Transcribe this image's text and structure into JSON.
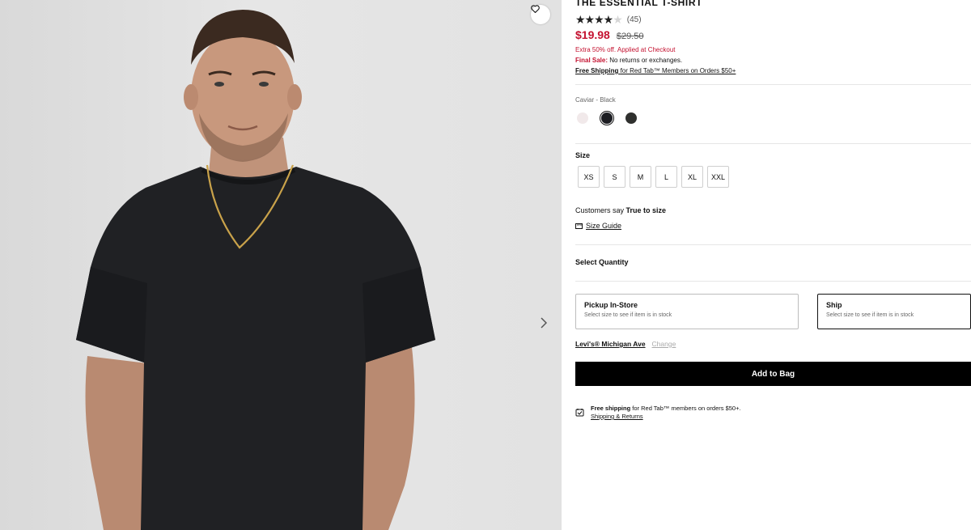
{
  "product": {
    "title": "THE ESSENTIAL T-SHIRT",
    "rating_stars": "★★★★",
    "rating_empty": "★",
    "rating_count": "(45)",
    "price": "$19.98",
    "price_original": "$29.50",
    "promo": "Extra 50% off. Applied at Checkout",
    "final_sale_label": "Final Sale:",
    "final_sale_text": "No returns or exchanges.",
    "free_shipping_bold": "Free Shipping",
    "free_shipping_text": "for Red Tab™ Members on Orders $50+"
  },
  "color": {
    "label": "Caviar - Black",
    "swatches": [
      {
        "name": "light",
        "hex": "#f1e9ea"
      },
      {
        "name": "caviar-black",
        "hex": "#1c1d22",
        "selected": true
      },
      {
        "name": "dark-gray",
        "hex": "#2f302e"
      }
    ]
  },
  "size": {
    "label": "Size",
    "options": [
      "XS",
      "S",
      "M",
      "L",
      "XL",
      "XXL"
    ],
    "fit_prefix": "Customers say",
    "fit_value": "True to size",
    "guide_label": "Size Guide"
  },
  "quantity": {
    "label": "Select Quantity"
  },
  "fulfillment": {
    "pickup_title": "Pickup In-Store",
    "pickup_sub": "Select size to see if item is in stock",
    "ship_title": "Ship",
    "ship_sub": "Select size to see if item is in stock"
  },
  "store": {
    "name": "Levi's® Michigan Ave",
    "change_label": "Change"
  },
  "cta": {
    "add_to_bag": "Add to Bag"
  },
  "shipping_note": {
    "bold": "Free shipping",
    "text": "for Red Tab™ members on orders $50+.",
    "link": "Shipping & Returns"
  },
  "icons": {
    "wishlist": "heart-icon",
    "next": "chevron-right-icon",
    "size_guide": "ruler-icon",
    "shipping": "box-icon"
  },
  "colors": {
    "sale_red": "#c41230",
    "cta_black": "#000000"
  }
}
